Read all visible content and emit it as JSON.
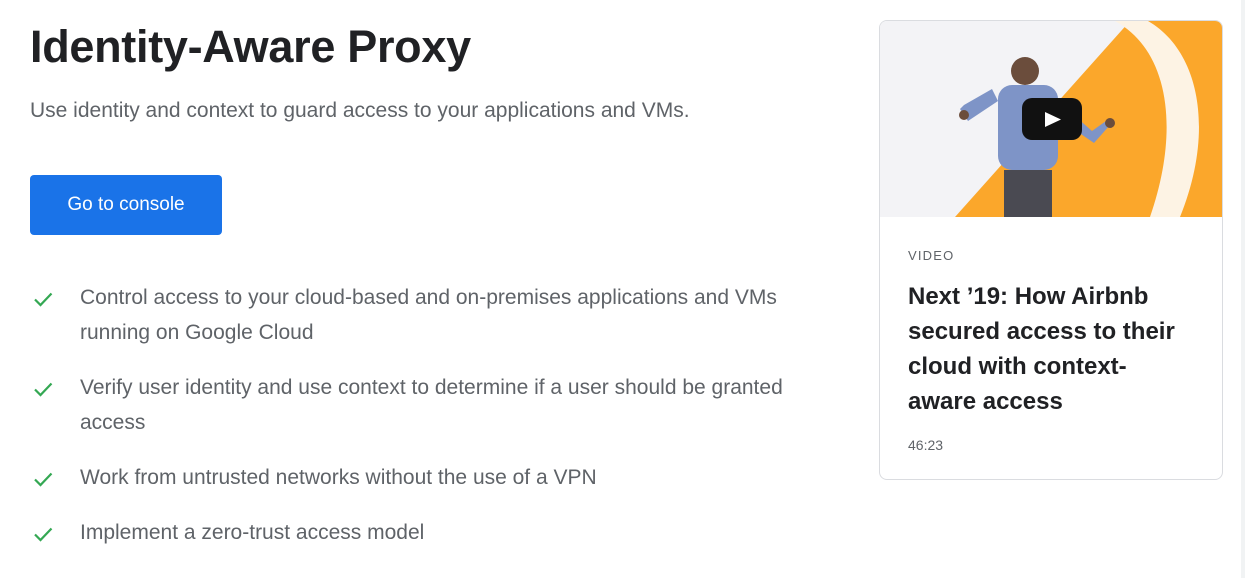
{
  "page": {
    "title": "Identity-Aware Proxy",
    "subtitle": "Use identity and context to guard access to your applications and VMs."
  },
  "cta": {
    "label": "Go to console"
  },
  "features": [
    "Control access to your cloud-based and on-premises applications and VMs running on Google Cloud",
    "Verify user identity and use context to determine if a user should be granted access",
    "Work from untrusted networks without the use of a VPN",
    "Implement a zero-trust access model"
  ],
  "video_card": {
    "label": "VIDEO",
    "title": "Next ’19: How Airbnb secured access to their cloud with context-aware access",
    "duration": "46:23",
    "thumbnail_icon": "play-icon"
  },
  "colors": {
    "primary": "#1a73e8",
    "check": "#34a853",
    "accent_orange": "#fba72b",
    "text_dark": "#202124",
    "text_muted": "#5f6368"
  }
}
